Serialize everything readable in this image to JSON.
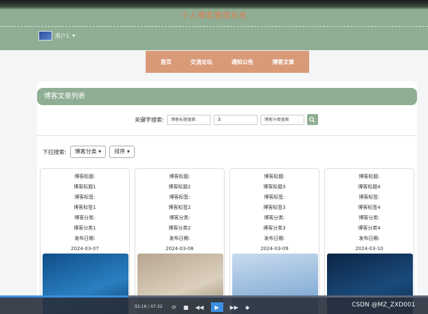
{
  "header": {
    "title": "个人博客管理系统",
    "user_label": "用户1"
  },
  "nav": {
    "items": [
      "首页",
      "交流论坛",
      "通知公告",
      "博客文章"
    ]
  },
  "panel": {
    "title": "博客文章列表"
  },
  "search": {
    "label": "关键字搜索:",
    "title_placeholder": "博客标题搜索",
    "tag_value": "3",
    "category_placeholder": "博客分类搜索"
  },
  "dropdown_filter": {
    "label": "下拉搜索:",
    "category_label": "博客分类",
    "sort_label": "排序"
  },
  "cards": [
    {
      "title_label": "博客标题:",
      "title": "博客标题1",
      "tag_label": "博客标签:",
      "tag": "博客标签1",
      "category_label": "博客分类:",
      "category": "博客分类1",
      "date_label": "发布日期:",
      "date": "2024-03-07"
    },
    {
      "title_label": "博客标题:",
      "title": "博客标题2",
      "tag_label": "博客标签:",
      "tag": "博客标签2",
      "category_label": "博客分类:",
      "category": "博客分类2",
      "date_label": "发布日期:",
      "date": "2024-03-08"
    },
    {
      "title_label": "博客标题:",
      "title": "博客标题3",
      "tag_label": "博客标签:",
      "tag": "博客标签3",
      "category_label": "博客分类:",
      "category": "博客分类3",
      "date_label": "发布日期:",
      "date": "2024-03-09"
    },
    {
      "title_label": "博客标题:",
      "title": "博客标题4",
      "tag_label": "博客标签:",
      "tag": "博客标签4",
      "category_label": "博客分类:",
      "category": "博客分类4",
      "date_label": "发布日期:",
      "date": "2024-03-10"
    }
  ],
  "video": {
    "time": "02:16 / 07:32",
    "progress": 0.3
  },
  "watermark": "CSDN @MZ_ZXD001",
  "colors": {
    "header_green": "#8fae93",
    "nav_orange": "#d99a78",
    "title_orange": "#c48e6a"
  }
}
